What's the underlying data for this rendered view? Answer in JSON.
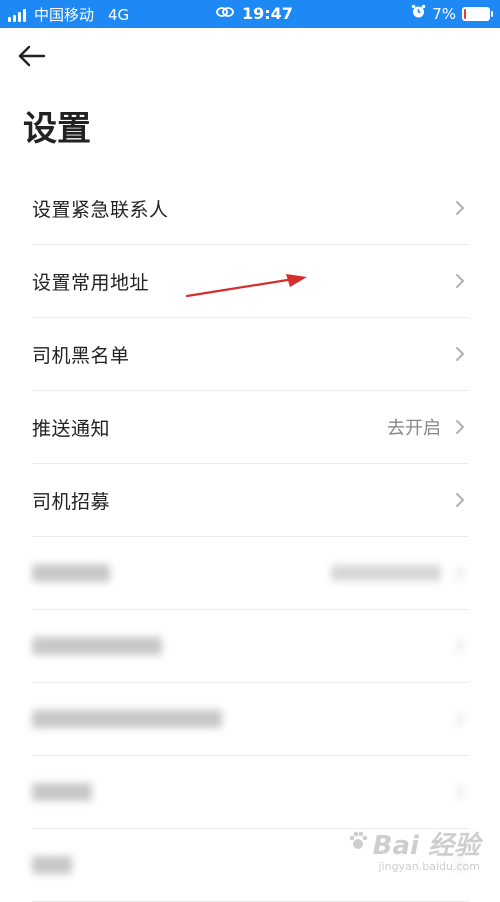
{
  "status_bar": {
    "carrier": "中国移动",
    "network": "4G",
    "time": "19:47",
    "battery_percent": "7%",
    "battery_level": 0.07,
    "background_color": "#1e88f5"
  },
  "header": {
    "back_icon": "back-arrow-icon",
    "title": "设置"
  },
  "settings": [
    {
      "label": "设置紧急联系人",
      "value": ""
    },
    {
      "label": "设置常用地址",
      "value": ""
    },
    {
      "label": "司机黑名单",
      "value": ""
    },
    {
      "label": "推送通知",
      "value": "去开启"
    },
    {
      "label": "司机招募",
      "value": ""
    }
  ],
  "blurred_rows_count": 5,
  "annotation": {
    "arrow_color": "#d32f2f"
  },
  "watermark": {
    "main": "Bai  经验",
    "sub": "jingyan.baidu.com"
  }
}
